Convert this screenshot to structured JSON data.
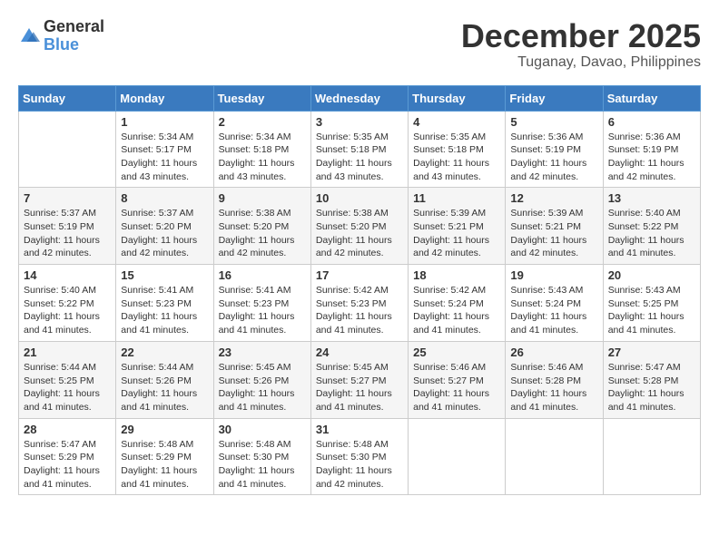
{
  "logo": {
    "general": "General",
    "blue": "Blue"
  },
  "title": {
    "month_year": "December 2025",
    "location": "Tuganay, Davao, Philippines"
  },
  "weekdays": [
    "Sunday",
    "Monday",
    "Tuesday",
    "Wednesday",
    "Thursday",
    "Friday",
    "Saturday"
  ],
  "weeks": [
    [
      {
        "day": "",
        "info": ""
      },
      {
        "day": "1",
        "info": "Sunrise: 5:34 AM\nSunset: 5:17 PM\nDaylight: 11 hours\nand 43 minutes."
      },
      {
        "day": "2",
        "info": "Sunrise: 5:34 AM\nSunset: 5:18 PM\nDaylight: 11 hours\nand 43 minutes."
      },
      {
        "day": "3",
        "info": "Sunrise: 5:35 AM\nSunset: 5:18 PM\nDaylight: 11 hours\nand 43 minutes."
      },
      {
        "day": "4",
        "info": "Sunrise: 5:35 AM\nSunset: 5:18 PM\nDaylight: 11 hours\nand 43 minutes."
      },
      {
        "day": "5",
        "info": "Sunrise: 5:36 AM\nSunset: 5:19 PM\nDaylight: 11 hours\nand 42 minutes."
      },
      {
        "day": "6",
        "info": "Sunrise: 5:36 AM\nSunset: 5:19 PM\nDaylight: 11 hours\nand 42 minutes."
      }
    ],
    [
      {
        "day": "7",
        "info": "Sunrise: 5:37 AM\nSunset: 5:19 PM\nDaylight: 11 hours\nand 42 minutes."
      },
      {
        "day": "8",
        "info": "Sunrise: 5:37 AM\nSunset: 5:20 PM\nDaylight: 11 hours\nand 42 minutes."
      },
      {
        "day": "9",
        "info": "Sunrise: 5:38 AM\nSunset: 5:20 PM\nDaylight: 11 hours\nand 42 minutes."
      },
      {
        "day": "10",
        "info": "Sunrise: 5:38 AM\nSunset: 5:20 PM\nDaylight: 11 hours\nand 42 minutes."
      },
      {
        "day": "11",
        "info": "Sunrise: 5:39 AM\nSunset: 5:21 PM\nDaylight: 11 hours\nand 42 minutes."
      },
      {
        "day": "12",
        "info": "Sunrise: 5:39 AM\nSunset: 5:21 PM\nDaylight: 11 hours\nand 42 minutes."
      },
      {
        "day": "13",
        "info": "Sunrise: 5:40 AM\nSunset: 5:22 PM\nDaylight: 11 hours\nand 41 minutes."
      }
    ],
    [
      {
        "day": "14",
        "info": "Sunrise: 5:40 AM\nSunset: 5:22 PM\nDaylight: 11 hours\nand 41 minutes."
      },
      {
        "day": "15",
        "info": "Sunrise: 5:41 AM\nSunset: 5:23 PM\nDaylight: 11 hours\nand 41 minutes."
      },
      {
        "day": "16",
        "info": "Sunrise: 5:41 AM\nSunset: 5:23 PM\nDaylight: 11 hours\nand 41 minutes."
      },
      {
        "day": "17",
        "info": "Sunrise: 5:42 AM\nSunset: 5:23 PM\nDaylight: 11 hours\nand 41 minutes."
      },
      {
        "day": "18",
        "info": "Sunrise: 5:42 AM\nSunset: 5:24 PM\nDaylight: 11 hours\nand 41 minutes."
      },
      {
        "day": "19",
        "info": "Sunrise: 5:43 AM\nSunset: 5:24 PM\nDaylight: 11 hours\nand 41 minutes."
      },
      {
        "day": "20",
        "info": "Sunrise: 5:43 AM\nSunset: 5:25 PM\nDaylight: 11 hours\nand 41 minutes."
      }
    ],
    [
      {
        "day": "21",
        "info": "Sunrise: 5:44 AM\nSunset: 5:25 PM\nDaylight: 11 hours\nand 41 minutes."
      },
      {
        "day": "22",
        "info": "Sunrise: 5:44 AM\nSunset: 5:26 PM\nDaylight: 11 hours\nand 41 minutes."
      },
      {
        "day": "23",
        "info": "Sunrise: 5:45 AM\nSunset: 5:26 PM\nDaylight: 11 hours\nand 41 minutes."
      },
      {
        "day": "24",
        "info": "Sunrise: 5:45 AM\nSunset: 5:27 PM\nDaylight: 11 hours\nand 41 minutes."
      },
      {
        "day": "25",
        "info": "Sunrise: 5:46 AM\nSunset: 5:27 PM\nDaylight: 11 hours\nand 41 minutes."
      },
      {
        "day": "26",
        "info": "Sunrise: 5:46 AM\nSunset: 5:28 PM\nDaylight: 11 hours\nand 41 minutes."
      },
      {
        "day": "27",
        "info": "Sunrise: 5:47 AM\nSunset: 5:28 PM\nDaylight: 11 hours\nand 41 minutes."
      }
    ],
    [
      {
        "day": "28",
        "info": "Sunrise: 5:47 AM\nSunset: 5:29 PM\nDaylight: 11 hours\nand 41 minutes."
      },
      {
        "day": "29",
        "info": "Sunrise: 5:48 AM\nSunset: 5:29 PM\nDaylight: 11 hours\nand 41 minutes."
      },
      {
        "day": "30",
        "info": "Sunrise: 5:48 AM\nSunset: 5:30 PM\nDaylight: 11 hours\nand 41 minutes."
      },
      {
        "day": "31",
        "info": "Sunrise: 5:48 AM\nSunset: 5:30 PM\nDaylight: 11 hours\nand 42 minutes."
      },
      {
        "day": "",
        "info": ""
      },
      {
        "day": "",
        "info": ""
      },
      {
        "day": "",
        "info": ""
      }
    ]
  ]
}
